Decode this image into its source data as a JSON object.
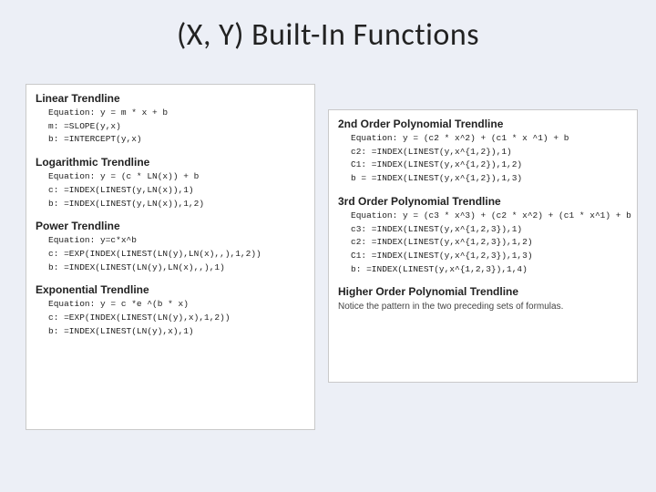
{
  "title": "(X, Y) Built-In Functions",
  "left": [
    {
      "heading": "Linear Trendline",
      "body": "Equation: y = m * x + b\nm: =SLOPE(y,x)\nb: =INTERCEPT(y,x)"
    },
    {
      "heading": "Logarithmic Trendline",
      "body": "Equation: y = (c * LN(x)) + b\nc: =INDEX(LINEST(y,LN(x)),1)\nb: =INDEX(LINEST(y,LN(x)),1,2)"
    },
    {
      "heading": "Power Trendline",
      "body": "Equation: y=c*x^b\nc: =EXP(INDEX(LINEST(LN(y),LN(x),,),1,2))\nb: =INDEX(LINEST(LN(y),LN(x),,),1)"
    },
    {
      "heading": "Exponential Trendline",
      "body": "Equation: y = c *e ^(b * x)\nc: =EXP(INDEX(LINEST(LN(y),x),1,2))\nb: =INDEX(LINEST(LN(y),x),1)"
    }
  ],
  "right": [
    {
      "heading": "2nd Order Polynomial Trendline",
      "body": "Equation: y = (c2 * x^2) + (c1 * x ^1) + b\nc2: =INDEX(LINEST(y,x^{1,2}),1)\nC1: =INDEX(LINEST(y,x^{1,2}),1,2)\nb = =INDEX(LINEST(y,x^{1,2}),1,3)"
    },
    {
      "heading": "3rd Order Polynomial Trendline",
      "body": "Equation: y = (c3 * x^3) + (c2 * x^2) + (c1 * x^1) + b\nc3: =INDEX(LINEST(y,x^{1,2,3}),1)\nc2: =INDEX(LINEST(y,x^{1,2,3}),1,2)\nC1: =INDEX(LINEST(y,x^{1,2,3}),1,3)\nb: =INDEX(LINEST(y,x^{1,2,3}),1,4)"
    },
    {
      "heading": "Higher Order Polynomial Trendline",
      "note": "Notice the pattern in the two preceding sets of formulas."
    }
  ]
}
